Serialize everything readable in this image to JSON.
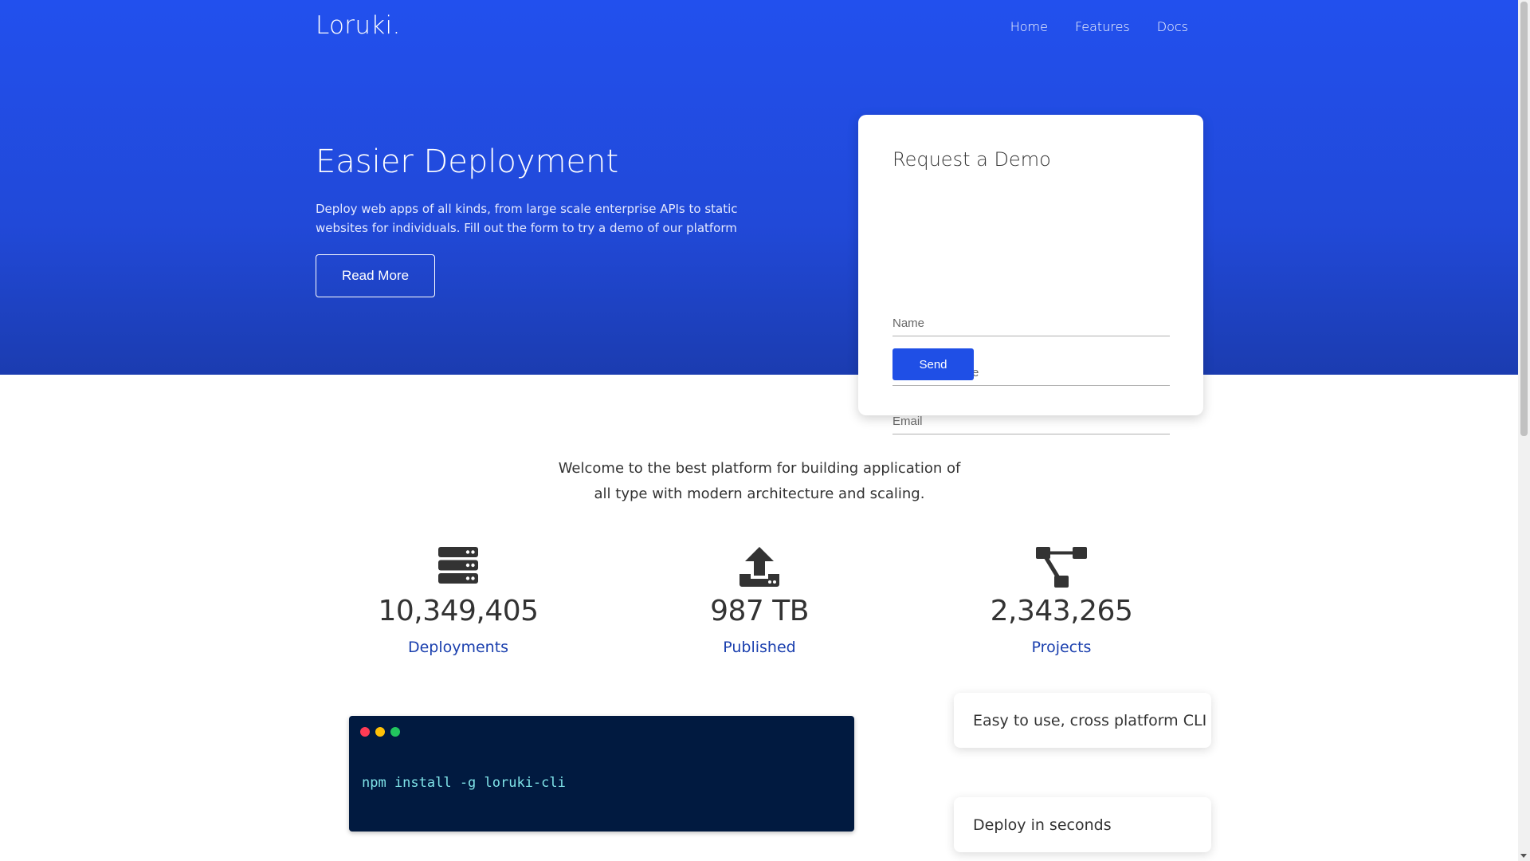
{
  "nav": {
    "logo": "Loruki.",
    "links": [
      "Home",
      "Features",
      "Docs"
    ]
  },
  "hero": {
    "title": "Easier Deployment",
    "description": "Deploy web apps of all kinds, from large scale enterprise APIs to static websites for individuals. Fill out the form to try a demo of our platform",
    "read_more_label": "Read More"
  },
  "demo_form": {
    "title": "Request a Demo",
    "name_placeholder": "Name",
    "company_placeholder": "Company Name",
    "email_placeholder": "Email",
    "send_label": "Send"
  },
  "welcome_text": "Welcome to the best platform for building application of all type with modern architecture and scaling.",
  "stats": [
    {
      "icon": "server-icon",
      "value": "10,349,405",
      "label": "Deployments"
    },
    {
      "icon": "upload-icon",
      "value": "987 TB",
      "label": "Published"
    },
    {
      "icon": "project-diagram-icon",
      "value": "2,343,265",
      "label": "Projects"
    }
  ],
  "terminal": {
    "command": "npm install -g loruki-cli"
  },
  "features": [
    "Easy to use, cross platform CLI",
    "Deploy in seconds"
  ],
  "colors": {
    "hero_gradient_top": "#2250ee",
    "hero_gradient_bottom": "#1b3cb0",
    "accent": "#1f4fe6",
    "stat_label": "#1a3fae",
    "terminal_bg": "#011a40",
    "terminal_text": "#7fe3e8"
  }
}
